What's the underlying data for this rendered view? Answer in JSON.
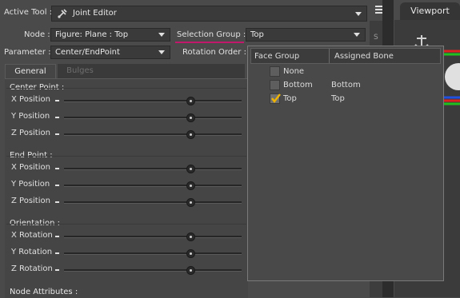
{
  "toolbar": {
    "active_tool_label": "Active Tool :",
    "active_tool_value": "Joint Editor",
    "node_label": "Node :",
    "node_value": "Figure: Plane : Top",
    "selection_group_label": "Selection Group :",
    "selection_group_value": "Top",
    "parameter_label": "Parameter :",
    "parameter_value": "Center/EndPoint",
    "rotation_order_label": "Rotation Order :"
  },
  "tabs": [
    "General",
    "Bulges"
  ],
  "groups": [
    {
      "title": "Center Point :",
      "rows": [
        {
          "label": "X Position",
          "level": 0.71
        },
        {
          "label": "Y Position",
          "level": 0.71
        },
        {
          "label": "Z Position",
          "level": 0.71
        }
      ]
    },
    {
      "title": "End Point :",
      "rows": [
        {
          "label": "X Position",
          "level": 0.71
        },
        {
          "label": "Y Position",
          "level": 0.71
        },
        {
          "label": "Z Position",
          "level": 0.71
        }
      ]
    },
    {
      "title": "Orientation :",
      "rows": [
        {
          "label": "X Rotation",
          "level": 0.71
        },
        {
          "label": "Y Rotation",
          "level": 0.71
        },
        {
          "label": "Z Rotation",
          "level": 0.71
        }
      ]
    }
  ],
  "node_attributes_title": "Node Attributes :",
  "popup": {
    "col_face_group": "Face Group",
    "col_assigned_bone": "Assigned Bone",
    "rows": [
      {
        "face_group": "None",
        "assigned_bone": "",
        "checked": false
      },
      {
        "face_group": "Bottom",
        "assigned_bone": "Bottom",
        "checked": false
      },
      {
        "face_group": "Top",
        "assigned_bone": "Top",
        "checked": true
      }
    ]
  },
  "viewport_tab": "Viewport",
  "side_strip_letter": "S",
  "colors": {
    "accent_underline": "#c2186b",
    "check_mark": "#f0b400",
    "gizmo_red": "#e02020",
    "gizmo_green": "#20c020",
    "gizmo_blue": "#2050e0"
  },
  "icons": [
    "joint-editor-icon",
    "panel-menu-icon",
    "dropdown-arrow-icon",
    "checkbox-icon",
    "viewport-gizmo-icon"
  ]
}
